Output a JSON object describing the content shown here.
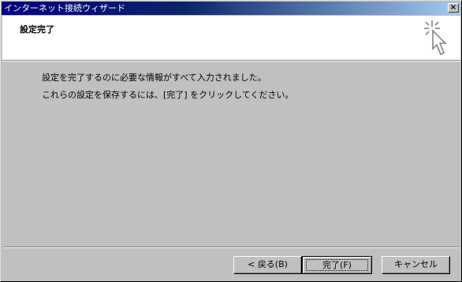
{
  "window": {
    "title": "インターネット接続ウィザード",
    "close_glyph": "×"
  },
  "header": {
    "title": "設定完了",
    "icon": "wizard-sparkle-cursor-icon"
  },
  "body": {
    "line1": "設定を完了するのに必要な情報がすべて入力されました。",
    "line2": "これらの設定を保存するには、[完了] をクリックしてください。"
  },
  "buttons": {
    "back": "< 戻る(B)",
    "finish": "完了(F)",
    "cancel": "キャンセル"
  }
}
